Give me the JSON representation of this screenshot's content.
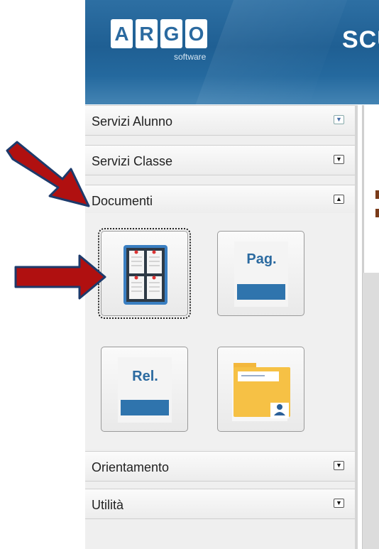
{
  "header": {
    "logo_letters": [
      "A",
      "R",
      "G",
      "O"
    ],
    "logo_subtitle": "software",
    "brand_title": "SCU"
  },
  "sidebar": {
    "sections": [
      {
        "label": "Servizi Alunno",
        "state": "collapsed"
      },
      {
        "label": "Servizi Classe",
        "state": "collapsed"
      },
      {
        "label": "Documenti",
        "state": "expanded"
      },
      {
        "label": "Orientamento",
        "state": "collapsed"
      },
      {
        "label": "Utilità",
        "state": "collapsed"
      }
    ],
    "document_tiles": [
      {
        "name": "bacheca-tile",
        "icon": "board-icon",
        "text": ""
      },
      {
        "name": "pagella-tile",
        "icon": "document-icon",
        "text": "Pag."
      },
      {
        "name": "relazione-tile",
        "icon": "document-icon",
        "text": "Rel."
      },
      {
        "name": "folder-tile",
        "icon": "folder-user-icon",
        "text": ""
      }
    ]
  },
  "colors": {
    "header_blue": "#2b6aa0",
    "annotation_arrow": "#b01010",
    "tile_bar": "#2f74ad"
  }
}
